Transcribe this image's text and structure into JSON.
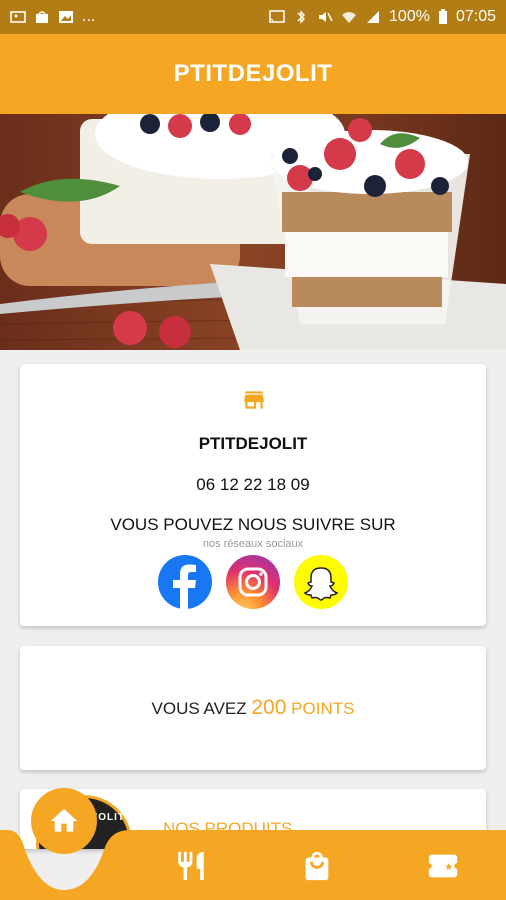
{
  "status_bar": {
    "battery": "100%",
    "time": "07:05",
    "more": "..."
  },
  "app": {
    "title": "PTITDEJOLIT"
  },
  "info_card": {
    "name": "PTITDEJOLIT",
    "phone": "06 12 22 18 09",
    "follow_text": "VOUS POUVEZ NOUS SUIVRE SUR",
    "follow_sub": "nos réseaux sociaux",
    "socials": [
      "facebook-icon",
      "instagram-icon",
      "snapchat-icon"
    ]
  },
  "points_card": {
    "prefix": "VOUS AVEZ",
    "points": "200",
    "suffix": "POINTS"
  },
  "products_card": {
    "logo_text": "PTIT DEJ'OLIT",
    "label": "NOS PRODUITS"
  },
  "colors": {
    "accent": "#f5a623",
    "status_bar": "#b27d14"
  },
  "bottom_nav": {
    "items": [
      "home-icon",
      "restaurant-icon",
      "bag-icon",
      "ticket-icon"
    ]
  }
}
